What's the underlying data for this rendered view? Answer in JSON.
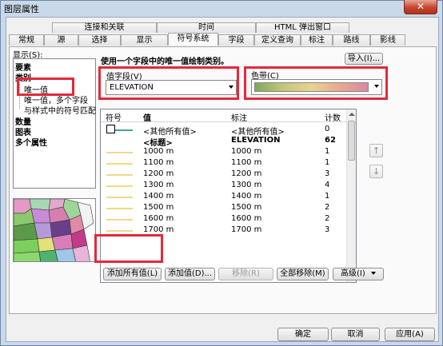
{
  "window": {
    "title": "图层属性",
    "close_glyph": "✕"
  },
  "tabs_row1": [
    "连接和关联",
    "时间",
    "HTML 弹出窗口"
  ],
  "tabs_row2": [
    "常规",
    "源",
    "选择",
    "显示",
    "符号系统",
    "字段",
    "定义查询",
    "标注",
    "路线",
    "影线"
  ],
  "active_tab": "符号系统",
  "sidebar": {
    "show_label": "显示(S):",
    "items": [
      "要素",
      "类别",
      "唯一值",
      "唯一值，多个字段",
      "与样式中的符号匹配",
      "数量",
      "图表",
      "多个属性"
    ]
  },
  "main": {
    "description": "使用一个字段中的唯一值绘制类别。",
    "import_label": "导入(I)...",
    "value_field_label": "值字段(V)",
    "value_field_value": "ELEVATION",
    "color_ramp_label": "色带(C)"
  },
  "table": {
    "headers": {
      "symbol": "符号",
      "value": "值",
      "label": "标注",
      "count": "计数"
    },
    "rows": [
      {
        "value": "<其他所有值>",
        "label": "<其他所有值>",
        "count": "0",
        "bold": false
      },
      {
        "value": "<标题>",
        "label": "ELEVATION",
        "count": "62",
        "bold": true
      },
      {
        "value": "1000 m",
        "label": "1000 m",
        "count": "1",
        "bold": false
      },
      {
        "value": "1100 m",
        "label": "1100 m",
        "count": "1",
        "bold": false
      },
      {
        "value": "1200 m",
        "label": "1200 m",
        "count": "3",
        "bold": false
      },
      {
        "value": "1300 m",
        "label": "1300 m",
        "count": "4",
        "bold": false
      },
      {
        "value": "1400 m",
        "label": "1400 m",
        "count": "1",
        "bold": false
      },
      {
        "value": "1500 m",
        "label": "1500 m",
        "count": "2",
        "bold": false
      },
      {
        "value": "1600 m",
        "label": "1600 m",
        "count": "2",
        "bold": false
      },
      {
        "value": "1700 m",
        "label": "1700 m",
        "count": "3",
        "bold": false
      }
    ]
  },
  "buttons": {
    "add_all": "添加所有值(L)",
    "add": "添加值(D)...",
    "remove": "移除(R)",
    "remove_all": "全部移除(M)",
    "advanced": "高级(I)",
    "ok": "确定",
    "cancel": "取消",
    "apply": "应用(A)"
  },
  "colors": {
    "highlight": "#e4283a",
    "line_symbol": "#4aa391",
    "line_values": "#f0d98a"
  }
}
